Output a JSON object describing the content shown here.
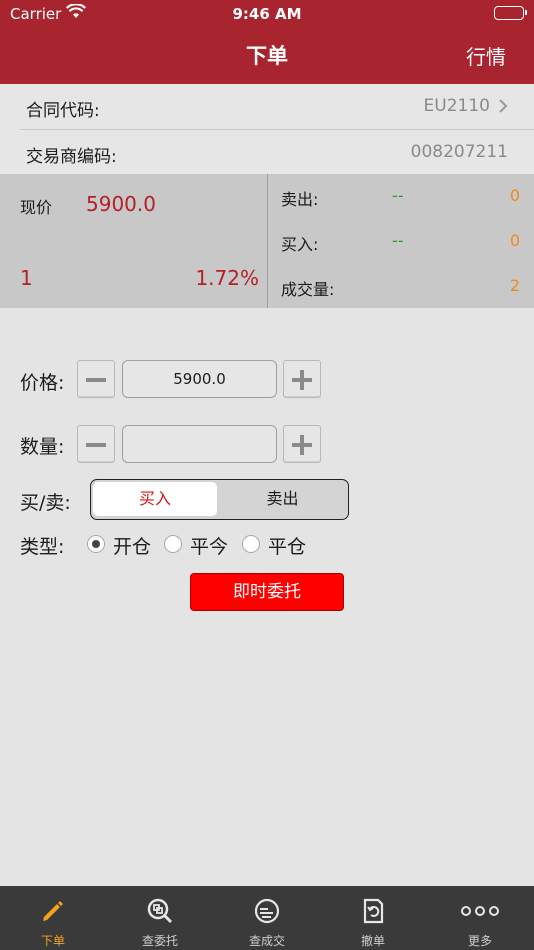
{
  "status_bar": {
    "carrier": "Carrier",
    "time": "9:46 AM"
  },
  "nav": {
    "title": "下单",
    "right": "行情"
  },
  "contract": {
    "label": "合同代码:",
    "value": "EU2110"
  },
  "broker": {
    "label": "交易商编码:",
    "value": "008207211"
  },
  "quote": {
    "price_label": "现价",
    "price": "5900.0",
    "change": "1",
    "change_pct": "1.72%",
    "sell_label": "卖出:",
    "sell_price": "--",
    "sell_qty": "0",
    "buy_label": "买入:",
    "buy_price": "--",
    "buy_qty": "0",
    "volume_label": "成交量:",
    "volume": "2"
  },
  "form": {
    "price_label": "价格:",
    "price_value": "5900.0",
    "qty_label": "数量:",
    "qty_value": "",
    "side_label": "买/卖:",
    "side_buy": "买入",
    "side_sell": "卖出",
    "type_label": "类型:",
    "type_options": [
      "开仓",
      "平今",
      "平仓"
    ],
    "type_selected": "开仓",
    "submit": "即时委托"
  },
  "tabs": [
    "下单",
    "查委托",
    "查成交",
    "撤单",
    "更多"
  ],
  "colors": {
    "header": "#a8252f",
    "accent_red": "#b51f26",
    "orange": "#f08a1c",
    "green": "#2a9a2a",
    "active_tab": "#f3a21b"
  }
}
